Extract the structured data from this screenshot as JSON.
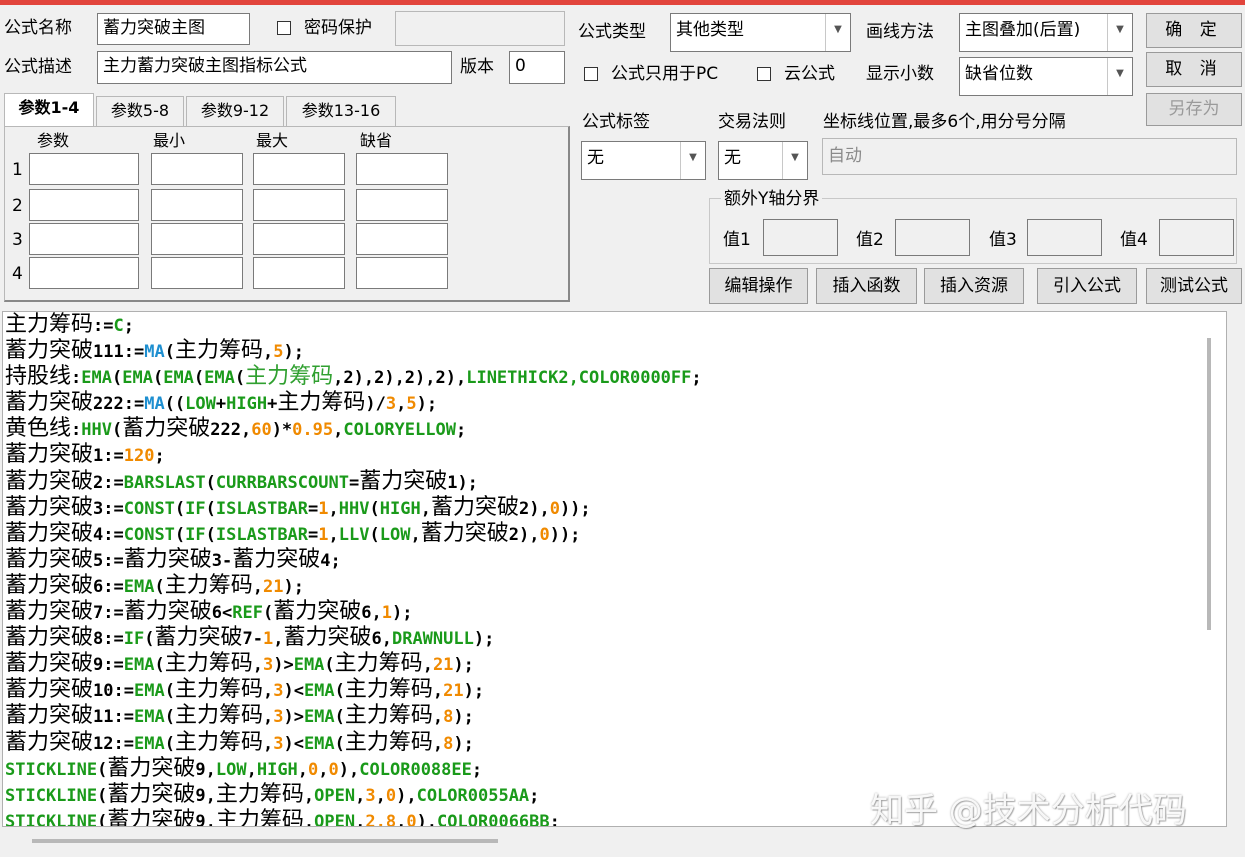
{
  "form": {
    "name_label": "公式名称",
    "name_value": "蓄力突破主图",
    "password_label": "密码保护",
    "password_value": "",
    "desc_label": "公式描述",
    "desc_value": "主力蓄力突破主图指标公式",
    "version_label": "版本",
    "version_value": "0",
    "type_label": "公式类型",
    "type_value": "其他类型",
    "draw_method_label": "画线方法",
    "draw_method_value": "主图叠加(后置)",
    "pc_only_label": "公式只用于PC",
    "cloud_label": "云公式",
    "decimals_label": "显示小数",
    "decimals_value": "缺省位数",
    "tag_label": "公式标签",
    "tag_value": "无",
    "trade_rule_label": "交易法则",
    "trade_rule_value": "无",
    "axis_label": "坐标线位置,最多6个,用分号分隔",
    "axis_placeholder": "自动",
    "y_bounds_title": "额外Y轴分界",
    "y_bound_labels": [
      "值1",
      "值2",
      "值3",
      "值4"
    ]
  },
  "buttons": {
    "ok": "确 定",
    "cancel": "取 消",
    "save_as": "另存为",
    "edit_ops": "编辑操作",
    "insert_func": "插入函数",
    "insert_res": "插入资源",
    "import_formula": "引入公式",
    "test_formula": "测试公式"
  },
  "params": {
    "tabs": [
      "参数1-4",
      "参数5-8",
      "参数9-12",
      "参数13-16"
    ],
    "active_tab": 0,
    "headers": [
      "参数",
      "最小",
      "最大",
      "缺省"
    ],
    "row_numbers": [
      "1",
      "2",
      "3",
      "4"
    ]
  },
  "colors": {
    "default": "#000000",
    "func": "#1a9a1a",
    "ma": "#1e8fd0",
    "num": "#f08a00",
    "var_green": "#30a030",
    "accent_bar": "#e2453c"
  },
  "code_lines": [
    [
      [
        "主力筹码",
        "cn"
      ],
      [
        ":=",
        ""
      ],
      [
        "C",
        "func"
      ],
      [
        ";",
        ""
      ]
    ],
    [
      [
        "蓄力突破",
        "cn"
      ],
      [
        "111:=",
        ""
      ],
      [
        "MA",
        "ma"
      ],
      [
        "(",
        ""
      ],
      [
        "主力筹码",
        "cn"
      ],
      [
        ",",
        ""
      ],
      [
        "5",
        "num"
      ],
      [
        ");",
        ""
      ]
    ],
    [
      [
        "持股线",
        "cn"
      ],
      [
        ":",
        ""
      ],
      [
        "EMA",
        "func"
      ],
      [
        "(",
        ""
      ],
      [
        "EMA",
        "func"
      ],
      [
        "(",
        ""
      ],
      [
        "EMA",
        "func"
      ],
      [
        "(",
        ""
      ],
      [
        "EMA",
        "func"
      ],
      [
        "(",
        ""
      ],
      [
        "主力筹码",
        "cnv"
      ],
      [
        ",2),2),2),2),",
        ""
      ],
      [
        "LINETHICK2,COLOR0000FF",
        "func"
      ],
      [
        ";",
        ""
      ]
    ],
    [
      [
        "蓄力突破",
        "cn"
      ],
      [
        "222:=",
        ""
      ],
      [
        "MA",
        "ma"
      ],
      [
        "((",
        ""
      ],
      [
        "LOW",
        "func"
      ],
      [
        "+",
        ""
      ],
      [
        "HIGH",
        "func"
      ],
      [
        "+",
        ""
      ],
      [
        "主力筹码",
        "cn"
      ],
      [
        ")/",
        ""
      ],
      [
        "3",
        "num"
      ],
      [
        ",",
        ""
      ],
      [
        "5",
        "num"
      ],
      [
        ");",
        ""
      ]
    ],
    [
      [
        "黄色线",
        "cn"
      ],
      [
        ":",
        ""
      ],
      [
        "HHV",
        "func"
      ],
      [
        "(",
        ""
      ],
      [
        "蓄力突破",
        "cn"
      ],
      [
        "222,",
        ""
      ],
      [
        "60",
        "num"
      ],
      [
        ")*",
        ""
      ],
      [
        "0.95",
        "num"
      ],
      [
        ",",
        ""
      ],
      [
        "COLORYELLOW",
        "func"
      ],
      [
        ";",
        ""
      ]
    ],
    [
      [
        "蓄力突破",
        "cn"
      ],
      [
        "1:=",
        ""
      ],
      [
        "120",
        "num"
      ],
      [
        ";",
        ""
      ]
    ],
    [
      [
        "蓄力突破",
        "cn"
      ],
      [
        "2:=",
        ""
      ],
      [
        "BARSLAST",
        "func"
      ],
      [
        "(",
        ""
      ],
      [
        "CURRBARSCOUNT",
        "func"
      ],
      [
        "=",
        ""
      ],
      [
        "蓄力突破",
        "cn"
      ],
      [
        "1);",
        ""
      ]
    ],
    [
      [
        "蓄力突破",
        "cn"
      ],
      [
        "3:=",
        ""
      ],
      [
        "CONST",
        "func"
      ],
      [
        "(",
        ""
      ],
      [
        "IF",
        "func"
      ],
      [
        "(",
        ""
      ],
      [
        "ISLASTBAR",
        "func"
      ],
      [
        "=",
        ""
      ],
      [
        "1",
        "num"
      ],
      [
        ",",
        ""
      ],
      [
        "HHV",
        "func"
      ],
      [
        "(",
        ""
      ],
      [
        "HIGH",
        "func"
      ],
      [
        ",",
        ""
      ],
      [
        "蓄力突破",
        "cn"
      ],
      [
        "2),",
        ""
      ],
      [
        "0",
        "num"
      ],
      [
        "));",
        ""
      ]
    ],
    [
      [
        "蓄力突破",
        "cn"
      ],
      [
        "4:=",
        ""
      ],
      [
        "CONST",
        "func"
      ],
      [
        "(",
        ""
      ],
      [
        "IF",
        "func"
      ],
      [
        "(",
        ""
      ],
      [
        "ISLASTBAR",
        "func"
      ],
      [
        "=",
        ""
      ],
      [
        "1",
        "num"
      ],
      [
        ",",
        ""
      ],
      [
        "LLV",
        "func"
      ],
      [
        "(",
        ""
      ],
      [
        "LOW",
        "func"
      ],
      [
        ",",
        ""
      ],
      [
        "蓄力突破",
        "cn"
      ],
      [
        "2),",
        ""
      ],
      [
        "0",
        "num"
      ],
      [
        "));",
        ""
      ]
    ],
    [
      [
        "蓄力突破",
        "cn"
      ],
      [
        "5:=",
        ""
      ],
      [
        "蓄力突破",
        "cn"
      ],
      [
        "3-",
        ""
      ],
      [
        "蓄力突破",
        "cn"
      ],
      [
        "4;",
        ""
      ]
    ],
    [
      [
        "蓄力突破",
        "cn"
      ],
      [
        "6:=",
        ""
      ],
      [
        "EMA",
        "func"
      ],
      [
        "(",
        ""
      ],
      [
        "主力筹码",
        "cn"
      ],
      [
        ",",
        ""
      ],
      [
        "21",
        "num"
      ],
      [
        ");",
        ""
      ]
    ],
    [
      [
        "蓄力突破",
        "cn"
      ],
      [
        "7:=",
        ""
      ],
      [
        "蓄力突破",
        "cn"
      ],
      [
        "6<",
        ""
      ],
      [
        "REF",
        "func"
      ],
      [
        "(",
        ""
      ],
      [
        "蓄力突破",
        "cn"
      ],
      [
        "6,",
        ""
      ],
      [
        "1",
        "num"
      ],
      [
        ");",
        ""
      ]
    ],
    [
      [
        "蓄力突破",
        "cn"
      ],
      [
        "8:=",
        ""
      ],
      [
        "IF",
        "func"
      ],
      [
        "(",
        ""
      ],
      [
        "蓄力突破",
        "cn"
      ],
      [
        "7-",
        ""
      ],
      [
        "1",
        "num"
      ],
      [
        ",",
        ""
      ],
      [
        "蓄力突破",
        "cn"
      ],
      [
        "6,",
        ""
      ],
      [
        "DRAWNULL",
        "func"
      ],
      [
        ");",
        ""
      ]
    ],
    [
      [
        "蓄力突破",
        "cn"
      ],
      [
        "9:=",
        ""
      ],
      [
        "EMA",
        "func"
      ],
      [
        "(",
        ""
      ],
      [
        "主力筹码",
        "cn"
      ],
      [
        ",",
        ""
      ],
      [
        "3",
        "num"
      ],
      [
        ")>",
        ""
      ],
      [
        "EMA",
        "func"
      ],
      [
        "(",
        ""
      ],
      [
        "主力筹码",
        "cn"
      ],
      [
        ",",
        ""
      ],
      [
        "21",
        "num"
      ],
      [
        ");",
        ""
      ]
    ],
    [
      [
        "蓄力突破",
        "cn"
      ],
      [
        "10:=",
        ""
      ],
      [
        "EMA",
        "func"
      ],
      [
        "(",
        ""
      ],
      [
        "主力筹码",
        "cn"
      ],
      [
        ",",
        ""
      ],
      [
        "3",
        "num"
      ],
      [
        ")<",
        ""
      ],
      [
        "EMA",
        "func"
      ],
      [
        "(",
        ""
      ],
      [
        "主力筹码",
        "cn"
      ],
      [
        ",",
        ""
      ],
      [
        "21",
        "num"
      ],
      [
        ");",
        ""
      ]
    ],
    [
      [
        "蓄力突破",
        "cn"
      ],
      [
        "11:=",
        ""
      ],
      [
        "EMA",
        "func"
      ],
      [
        "(",
        ""
      ],
      [
        "主力筹码",
        "cn"
      ],
      [
        ",",
        ""
      ],
      [
        "3",
        "num"
      ],
      [
        ")>",
        ""
      ],
      [
        "EMA",
        "func"
      ],
      [
        "(",
        ""
      ],
      [
        "主力筹码",
        "cn"
      ],
      [
        ",",
        ""
      ],
      [
        "8",
        "num"
      ],
      [
        ");",
        ""
      ]
    ],
    [
      [
        "蓄力突破",
        "cn"
      ],
      [
        "12:=",
        ""
      ],
      [
        "EMA",
        "func"
      ],
      [
        "(",
        ""
      ],
      [
        "主力筹码",
        "cn"
      ],
      [
        ",",
        ""
      ],
      [
        "3",
        "num"
      ],
      [
        ")<",
        ""
      ],
      [
        "EMA",
        "func"
      ],
      [
        "(",
        ""
      ],
      [
        "主力筹码",
        "cn"
      ],
      [
        ",",
        ""
      ],
      [
        "8",
        "num"
      ],
      [
        ");",
        ""
      ]
    ],
    [
      [
        "STICKLINE",
        "func"
      ],
      [
        "(",
        ""
      ],
      [
        "蓄力突破",
        "cn"
      ],
      [
        "9,",
        ""
      ],
      [
        "LOW",
        "func"
      ],
      [
        ",",
        ""
      ],
      [
        "HIGH",
        "func"
      ],
      [
        ",",
        ""
      ],
      [
        "0",
        "num"
      ],
      [
        ",",
        ""
      ],
      [
        "0",
        "num"
      ],
      [
        "),",
        ""
      ],
      [
        "COLOR0088EE",
        "func"
      ],
      [
        ";",
        ""
      ]
    ],
    [
      [
        "STICKLINE",
        "func"
      ],
      [
        "(",
        ""
      ],
      [
        "蓄力突破",
        "cn"
      ],
      [
        "9,",
        ""
      ],
      [
        "主力筹码",
        "cn"
      ],
      [
        ",",
        ""
      ],
      [
        "OPEN",
        "func"
      ],
      [
        ",",
        ""
      ],
      [
        "3",
        "num"
      ],
      [
        ",",
        ""
      ],
      [
        "0",
        "num"
      ],
      [
        "),",
        ""
      ],
      [
        "COLOR0055AA",
        "func"
      ],
      [
        ";",
        ""
      ]
    ],
    [
      [
        "STICKLINE",
        "func"
      ],
      [
        "(",
        ""
      ],
      [
        "蓄力突破",
        "cn"
      ],
      [
        "9,",
        ""
      ],
      [
        "主力筹码",
        "cn"
      ],
      [
        ",",
        ""
      ],
      [
        "OPEN",
        "func"
      ],
      [
        ",",
        ""
      ],
      [
        "2.8",
        "num"
      ],
      [
        ",",
        ""
      ],
      [
        "0",
        "num"
      ],
      [
        "),",
        ""
      ],
      [
        "COLOR0066BB",
        "func"
      ],
      [
        ";",
        ""
      ]
    ]
  ],
  "watermark": "知乎 @技术分析代码"
}
